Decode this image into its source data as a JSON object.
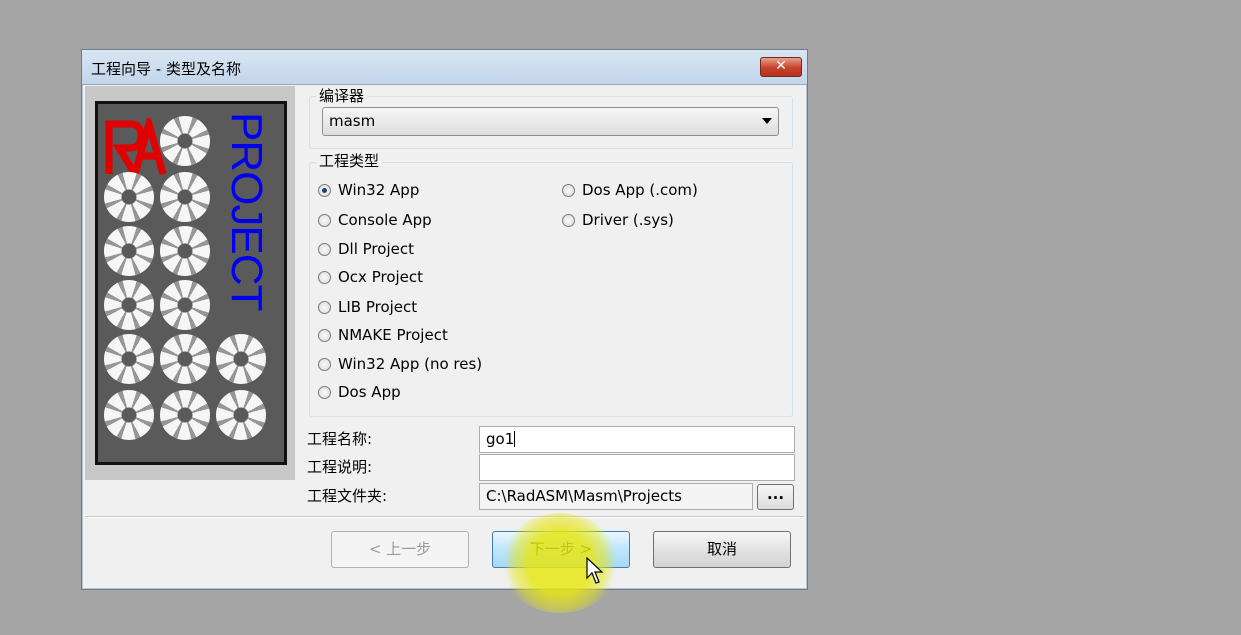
{
  "window": {
    "title": "工程向导 - 类型及名称",
    "close_label": "✕"
  },
  "logo": {
    "ra_text": "RA",
    "project_text": "PROJECT"
  },
  "compiler": {
    "group_label": "编译器",
    "selected": "masm"
  },
  "project_type": {
    "group_label": "工程类型",
    "options": [
      {
        "label": "Win32 App",
        "checked": true
      },
      {
        "label": "Console App",
        "checked": false
      },
      {
        "label": "Dll Project",
        "checked": false
      },
      {
        "label": "Ocx Project",
        "checked": false
      },
      {
        "label": "LIB Project",
        "checked": false
      },
      {
        "label": "NMAKE Project",
        "checked": false
      },
      {
        "label": "Win32 App (no res)",
        "checked": false
      },
      {
        "label": "Dos App",
        "checked": false
      },
      {
        "label": "Dos App (.com)",
        "checked": false
      },
      {
        "label": "Driver (.sys)",
        "checked": false
      }
    ]
  },
  "fields": {
    "name_label": "工程名称:",
    "name_value": "go1",
    "desc_label": "工程说明:",
    "desc_value": "",
    "folder_label": "工程文件夹:",
    "folder_value": "C:\\RadASM\\Masm\\Projects",
    "browse_label": "..."
  },
  "buttons": {
    "back": "< 上一步",
    "next": "下一步 >",
    "cancel": "取消"
  },
  "colors": {
    "background": "#a5a5a5",
    "dialog": "#f0f0f0",
    "project_text": "#0000ee",
    "ra_red": "#e00000",
    "highlight": "#e6e614"
  }
}
